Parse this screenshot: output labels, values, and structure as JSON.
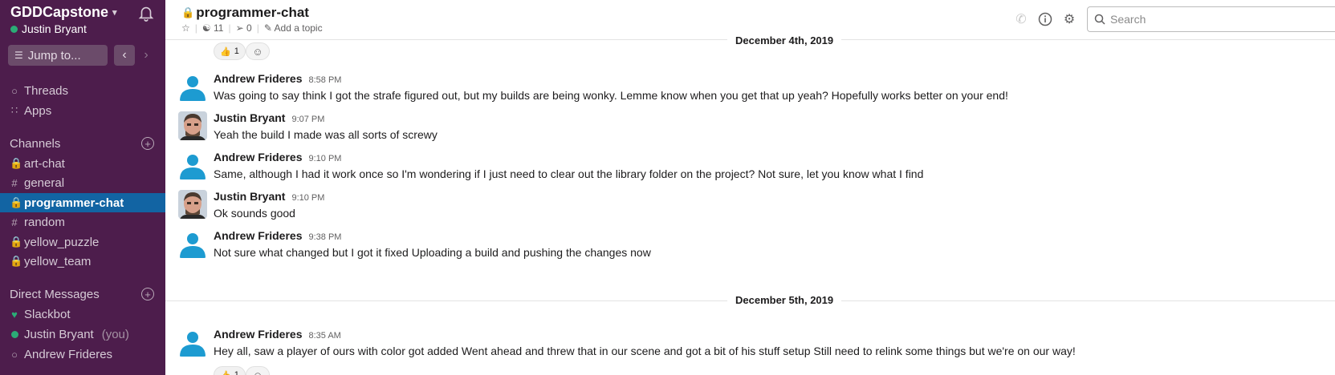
{
  "workspace": {
    "name": "GDDCapstone",
    "user": "Justin Bryant"
  },
  "sidebar": {
    "jump_label": "Jump to...",
    "threads": "Threads",
    "apps": "Apps",
    "channels_heading": "Channels",
    "channels": [
      {
        "label": "art-chat",
        "icon": "lock-icon"
      },
      {
        "label": "general",
        "icon": "hash-icon"
      },
      {
        "label": "programmer-chat",
        "icon": "lock-icon"
      },
      {
        "label": "random",
        "icon": "hash-icon"
      },
      {
        "label": "yellow_puzzle",
        "icon": "lock-icon"
      },
      {
        "label": "yellow_team",
        "icon": "lock-icon"
      }
    ],
    "dm_heading": "Direct Messages",
    "dms": [
      {
        "label": "Slackbot"
      },
      {
        "label": "Justin Bryant",
        "suffix": "(you)"
      },
      {
        "label": "Andrew Frideres"
      }
    ]
  },
  "header": {
    "channel": "programmer-chat",
    "members": "11",
    "pins": "0",
    "add_topic": "Add a topic",
    "search_placeholder": "Search"
  },
  "dates": [
    "December 4th, 2019",
    "December 5th, 2019"
  ],
  "reactions": {
    "top_count": "1",
    "bottom_count": "1"
  },
  "messages": [
    {
      "author": "Andrew Frideres",
      "time": "8:58 PM",
      "text": "Was going to say think I got the strafe figured out, but my builds are being wonky. Lemme know when you get that up yeah? Hopefully works better on your end!"
    },
    {
      "author": "Justin Bryant",
      "time": "9:07 PM",
      "text": "Yeah the build I made was all sorts of screwy"
    },
    {
      "author": "Andrew Frideres",
      "time": "9:10 PM",
      "text": "Same, although I had it work once so I'm wondering if I just need to clear out the library folder on the project? Not sure, let you know what I find"
    },
    {
      "author": "Justin Bryant",
      "time": "9:10 PM",
      "text": "Ok sounds good"
    },
    {
      "author": "Andrew Frideres",
      "time": "9:38 PM",
      "text": "Not sure what changed but I got it fixed Uploading a build and pushing the changes now"
    },
    {
      "author": "Andrew Frideres",
      "time": "8:35 AM",
      "text": "Hey all, saw a player of ours with color got added Went ahead and threw that in our scene and got a bit of his stuff setup Still need to relink some things but we're on our way!"
    }
  ],
  "colors": {
    "sidebar": "#4d1d4c",
    "active": "#1264a3",
    "online": "#2bac76",
    "avatar_blue": "#1d9bd1"
  }
}
